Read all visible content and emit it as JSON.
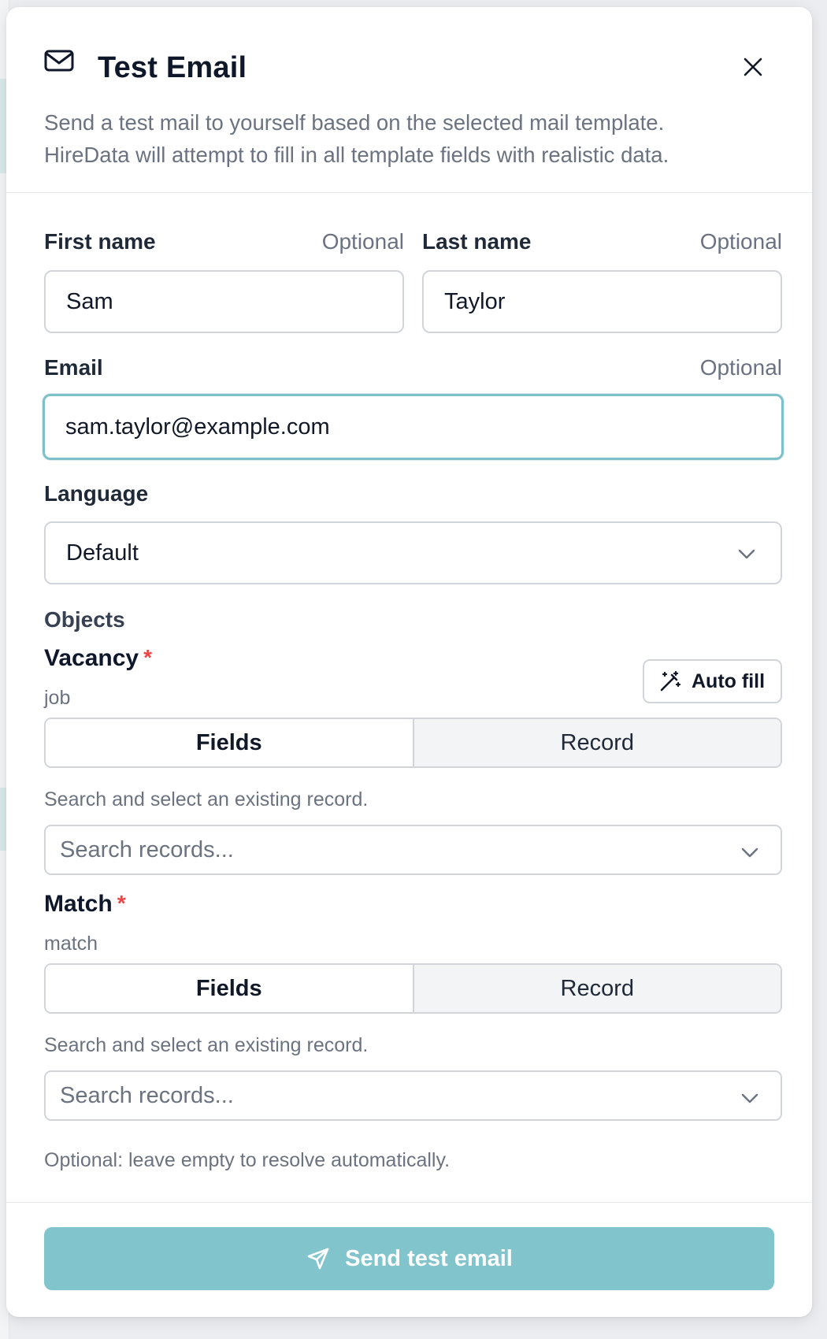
{
  "dialog": {
    "title": "Test Email",
    "description": "Send a test mail to yourself based on the selected mail template. HireData will attempt to fill in all template fields with realistic data."
  },
  "form": {
    "first_name": {
      "label": "First name",
      "optional": "Optional",
      "value": "Sam"
    },
    "last_name": {
      "label": "Last name",
      "optional": "Optional",
      "value": "Taylor"
    },
    "email": {
      "label": "Email",
      "optional": "Optional",
      "value": "sam.taylor@example.com"
    },
    "language": {
      "label": "Language",
      "value": "Default"
    }
  },
  "objects": {
    "section_label": "Objects",
    "vacancy": {
      "name": "Vacancy",
      "required_mark": "*",
      "key": "job",
      "autofill_label": "Auto fill",
      "tabs": [
        "Fields",
        "Record"
      ],
      "active_tab": "Fields",
      "helper": "Search and select an existing record.",
      "search_placeholder": "Search records..."
    },
    "match": {
      "name": "Match",
      "required_mark": "*",
      "key": "match",
      "tabs": [
        "Fields",
        "Record"
      ],
      "active_tab": "Fields",
      "helper": "Search and select an existing record.",
      "search_placeholder": "Search records..."
    },
    "note": "Optional: leave empty to resolve automatically."
  },
  "footer": {
    "send_label": "Send test email"
  },
  "icons": {
    "header": "mail-icon",
    "close": "close-icon",
    "chevron": "chevron-down-icon",
    "autofill": "magic-wand-icon",
    "send": "send-icon"
  },
  "colors": {
    "accent": "#82c4cb",
    "focus_ring": "#7ec0c7",
    "required": "#ef4444",
    "muted_text": "#6b7280"
  }
}
